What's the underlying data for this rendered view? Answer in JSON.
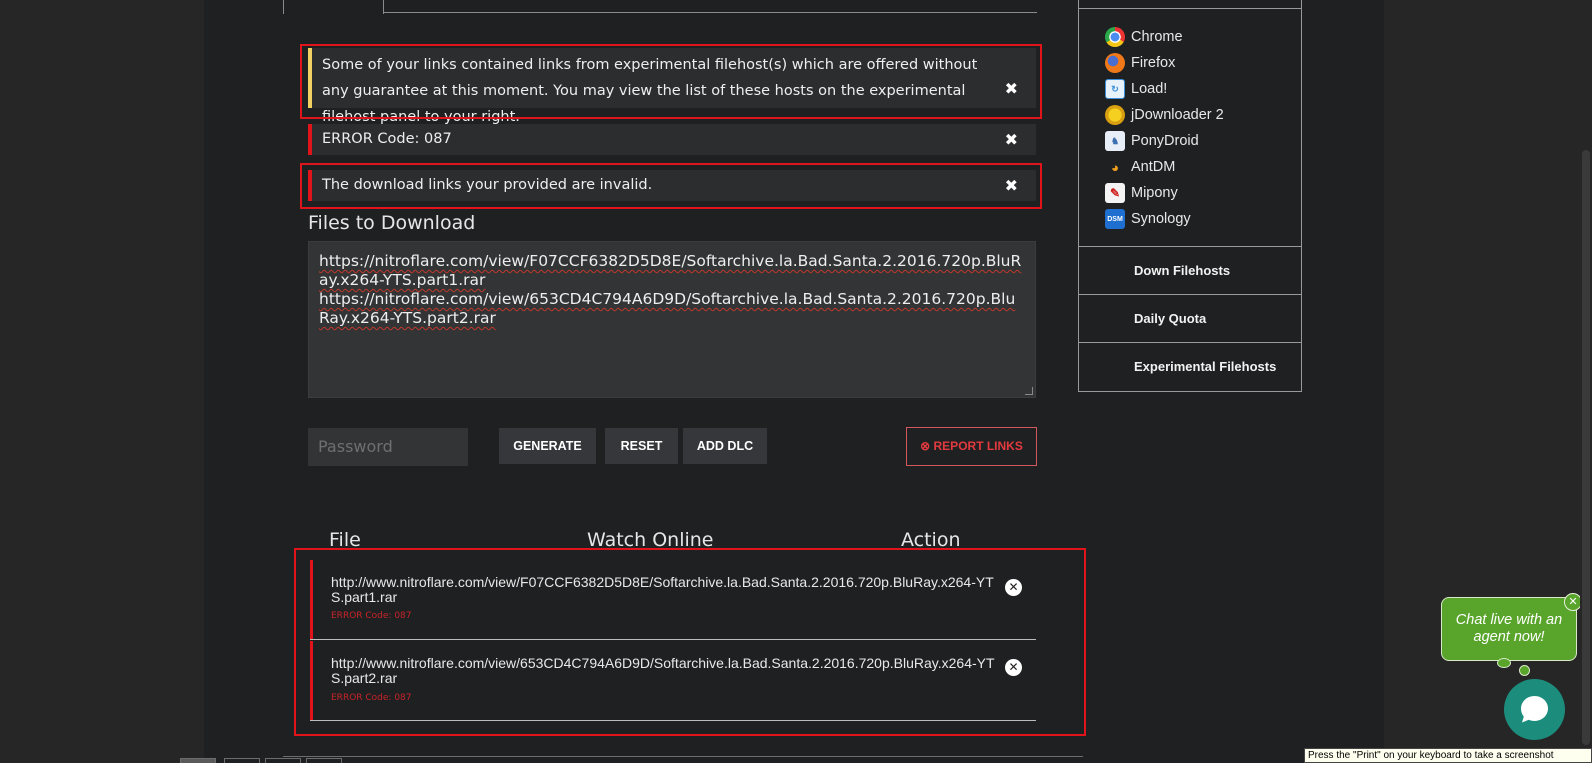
{
  "alerts": {
    "experimental": "Some of your links contained links from experimental filehost(s) which are offered without any guarantee at this moment. You may view the list of these hosts on the experimental filehost panel to your right.",
    "error_code": "ERROR Code: 087",
    "invalid": "The download links your provided are invalid.",
    "close_glyph": "✖"
  },
  "files_section": {
    "title": "Files to Download",
    "links": [
      "https://nitroflare.com/view/F07CCF6382D5D8E/Softarchive.la.Bad.Santa.2.2016.720p.BluRay.x264-YTS.part1.rar",
      "https://nitroflare.com/view/653CD4C794A6D9D/Softarchive.la.Bad.Santa.2.2016.720p.BluRay.x264-YTS.part2.rar"
    ]
  },
  "form": {
    "password_placeholder": "Password",
    "generate_label": "GENERATE",
    "reset_label": "RESET",
    "add_dlc_label": "ADD DLC",
    "report_links_label": "REPORT LINKS"
  },
  "results_table": {
    "headers": [
      "File",
      "Watch Online",
      "Action"
    ],
    "rows": [
      {
        "url": "http://www.nitroflare.com/view/F07CCF6382D5D8E/Softarchive.la.Bad.Santa.2.2016.720p.BluRay.x264-YTS.part1.rar",
        "error": "ERROR Code: 087"
      },
      {
        "url": "http://www.nitroflare.com/view/653CD4C794A6D9D/Softarchive.la.Bad.Santa.2.2016.720p.BluRay.x264-YTS.part2.rar",
        "error": "ERROR Code: 087"
      }
    ]
  },
  "sidebar": {
    "apps": [
      {
        "label": "Chrome",
        "icon": "chrome-icon"
      },
      {
        "label": "Firefox",
        "icon": "firefox-icon"
      },
      {
        "label": "Load!",
        "icon": "load-icon"
      },
      {
        "label": "jDownloader 2",
        "icon": "jdownloader-icon"
      },
      {
        "label": "PonyDroid",
        "icon": "ponydroid-icon"
      },
      {
        "label": "AntDM",
        "icon": "antdm-icon"
      },
      {
        "label": "Mipony",
        "icon": "mipony-icon"
      },
      {
        "label": "Synology",
        "icon": "synology-icon",
        "icon_text": "DSM"
      }
    ],
    "links": [
      "Down Filehosts",
      "Daily Quota",
      "Experimental Filehosts"
    ]
  },
  "chat": {
    "bubble_text": "Chat live with an agent now!",
    "close_glyph": "✕"
  },
  "tooltip": "Press the \"Print\" on your keyboard to take a screenshot",
  "colors": {
    "accent_red": "#e0141b",
    "warning_yellow": "#f0d060",
    "chat_green": "#59a52c",
    "chat_teal": "#1c8d7d"
  }
}
